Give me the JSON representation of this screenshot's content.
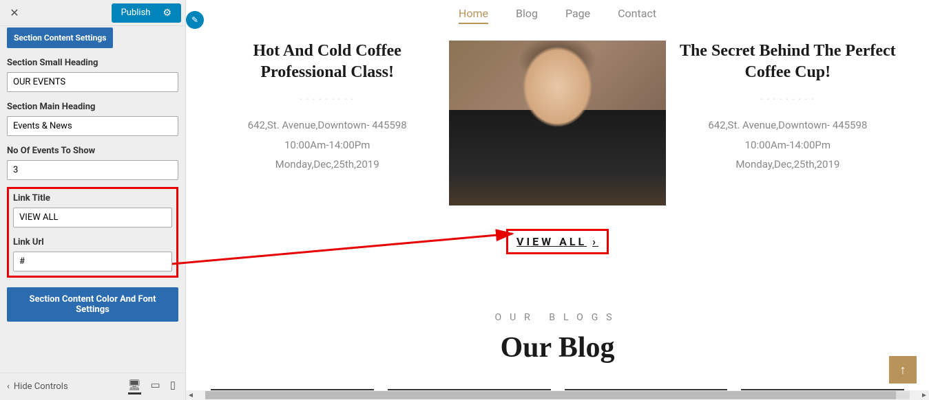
{
  "sidebar": {
    "publish_label": "Publish",
    "section_content_settings": "Section Content Settings",
    "fields": {
      "small_heading_label": "Section Small Heading",
      "small_heading_value": "OUR EVENTS",
      "main_heading_label": "Section Main Heading",
      "main_heading_value": "Events & News",
      "no_events_label": "No Of Events To Show",
      "no_events_value": "3",
      "link_title_label": "Link Title",
      "link_title_value": "VIEW ALL",
      "link_url_label": "Link Url",
      "link_url_value": "#"
    },
    "color_font_btn": "Section Content Color And Font Settings",
    "hide_controls": "Hide Controls"
  },
  "nav": {
    "items": [
      "Home",
      "Blog",
      "Page",
      "Contact"
    ]
  },
  "events": [
    {
      "title": "Hot And Cold Coffee Professional Class!",
      "address": "642,St. Avenue,Downtown- 445598",
      "time": "10:00Am-14:00Pm",
      "date": "Monday,Dec,25th,2019"
    },
    {
      "title": "The Secret Behind The Perfect Coffee Cup!",
      "address": "642,St. Avenue,Downtown- 445598",
      "time": "10:00Am-14:00Pm",
      "date": "Monday,Dec,25th,2019"
    }
  ],
  "view_all": "VIEW ALL",
  "blog": {
    "small": "OUR BLOGS",
    "main": "Our Blog"
  }
}
